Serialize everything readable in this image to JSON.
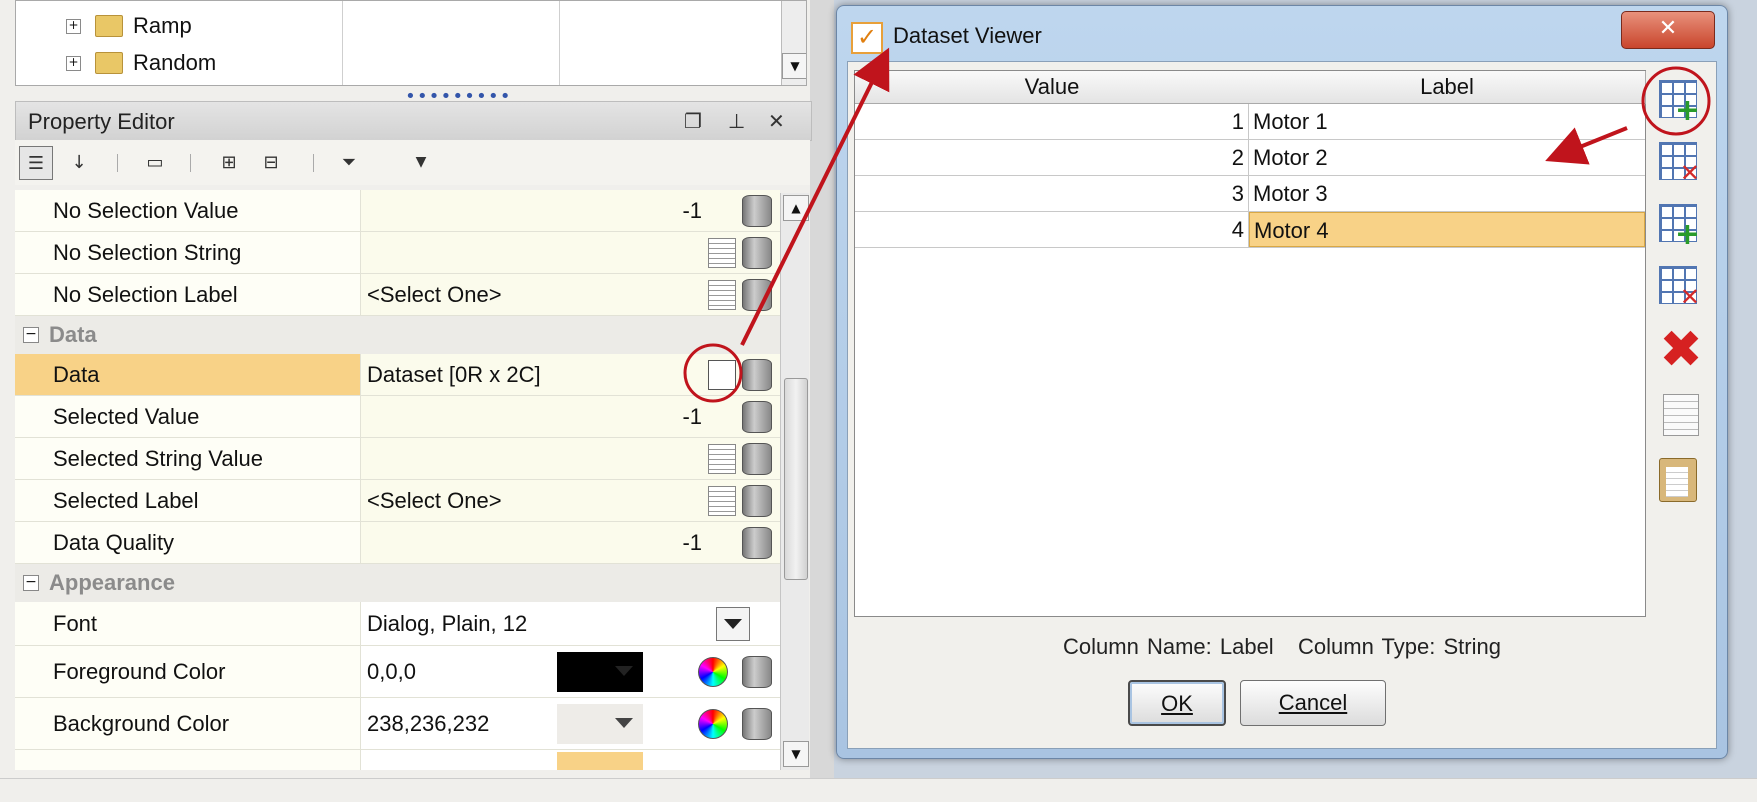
{
  "tree": {
    "items": [
      {
        "label": "Ramp"
      },
      {
        "label": "Random"
      }
    ]
  },
  "property_editor": {
    "title": "Property Editor",
    "rows_top": [
      {
        "name": "No Selection Value",
        "value": "-1"
      },
      {
        "name": "No Selection String",
        "value": ""
      },
      {
        "name": "No Selection Label",
        "value": "<Select One>"
      }
    ],
    "category_data": "Data",
    "rows_data": [
      {
        "name": "Data",
        "value": "Dataset [0R x 2C]"
      },
      {
        "name": "Selected Value",
        "value": "-1"
      },
      {
        "name": "Selected String Value",
        "value": ""
      },
      {
        "name": "Selected Label",
        "value": "<Select One>"
      },
      {
        "name": "Data Quality",
        "value": "-1"
      }
    ],
    "category_appearance": "Appearance",
    "rows_appearance": [
      {
        "name": "Font",
        "value": "Dialog, Plain, 12"
      },
      {
        "name": "Foreground Color",
        "value": "0,0,0",
        "swatch": "#000000"
      },
      {
        "name": "Background Color",
        "value": "238,236,232",
        "swatch": "#eeece8"
      }
    ]
  },
  "dialog": {
    "title": "Dataset Viewer",
    "columns": [
      "Value",
      "Label"
    ],
    "rows": [
      {
        "value": "1",
        "label": "Motor 1"
      },
      {
        "value": "2",
        "label": "Motor 2"
      },
      {
        "value": "3",
        "label": "Motor 3"
      },
      {
        "value": "4",
        "label": "Motor 4"
      }
    ],
    "column_info": "Column Name: Label   Column Type: String",
    "ok_label": "OK",
    "cancel_label": "Cancel",
    "close_glyph": "✕"
  },
  "colors": {
    "selection": "#f8d287",
    "annotation": "#c0141c",
    "dialog_frame": "#a9c4e2"
  }
}
